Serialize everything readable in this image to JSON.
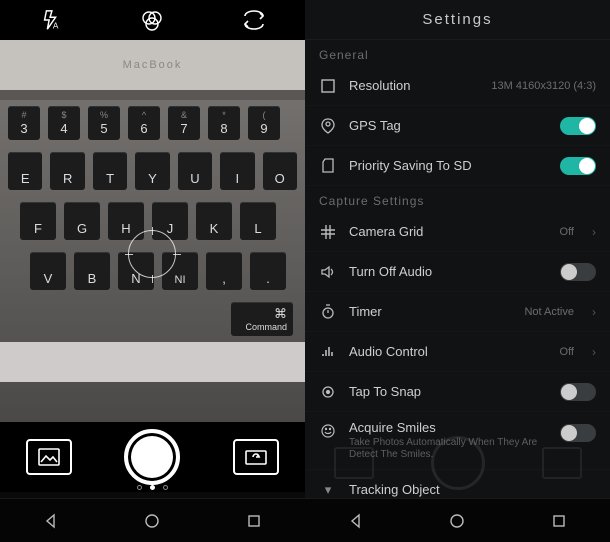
{
  "left": {
    "preview_label": "MacBook",
    "icons": {
      "flash": "flash-auto-icon",
      "filter": "filter-icon",
      "flip": "flip-icon",
      "gallery": "gallery-icon",
      "switch": "switch-camera-icon"
    }
  },
  "right": {
    "title": "Settings",
    "sections": {
      "general": "General",
      "capture": "Capture Settings"
    },
    "rows": {
      "resolution": {
        "label": "Resolution",
        "value": "13M 4160x3120 (4:3)"
      },
      "gps": {
        "label": "GPS Tag",
        "on": true
      },
      "sd": {
        "label": "Priority Saving To SD",
        "on": true
      },
      "grid": {
        "label": "Camera Grid",
        "value": "Off"
      },
      "audio_off": {
        "label": "Turn Off Audio",
        "on": false
      },
      "timer": {
        "label": "Timer",
        "value": "Not Active"
      },
      "audio_ctrl": {
        "label": "Audio Control",
        "value": "Off"
      },
      "tap": {
        "label": "Tap To Snap",
        "on": false
      },
      "smiles": {
        "label": "Acquire Smiles",
        "sub": "Take Photos Automatically When They Are Detect The Smiles.",
        "on": false
      },
      "tracking": {
        "label": "Tracking Object"
      }
    }
  },
  "nav": {
    "back": "◁",
    "home": "○",
    "recent": "□",
    "back2": "◁"
  }
}
